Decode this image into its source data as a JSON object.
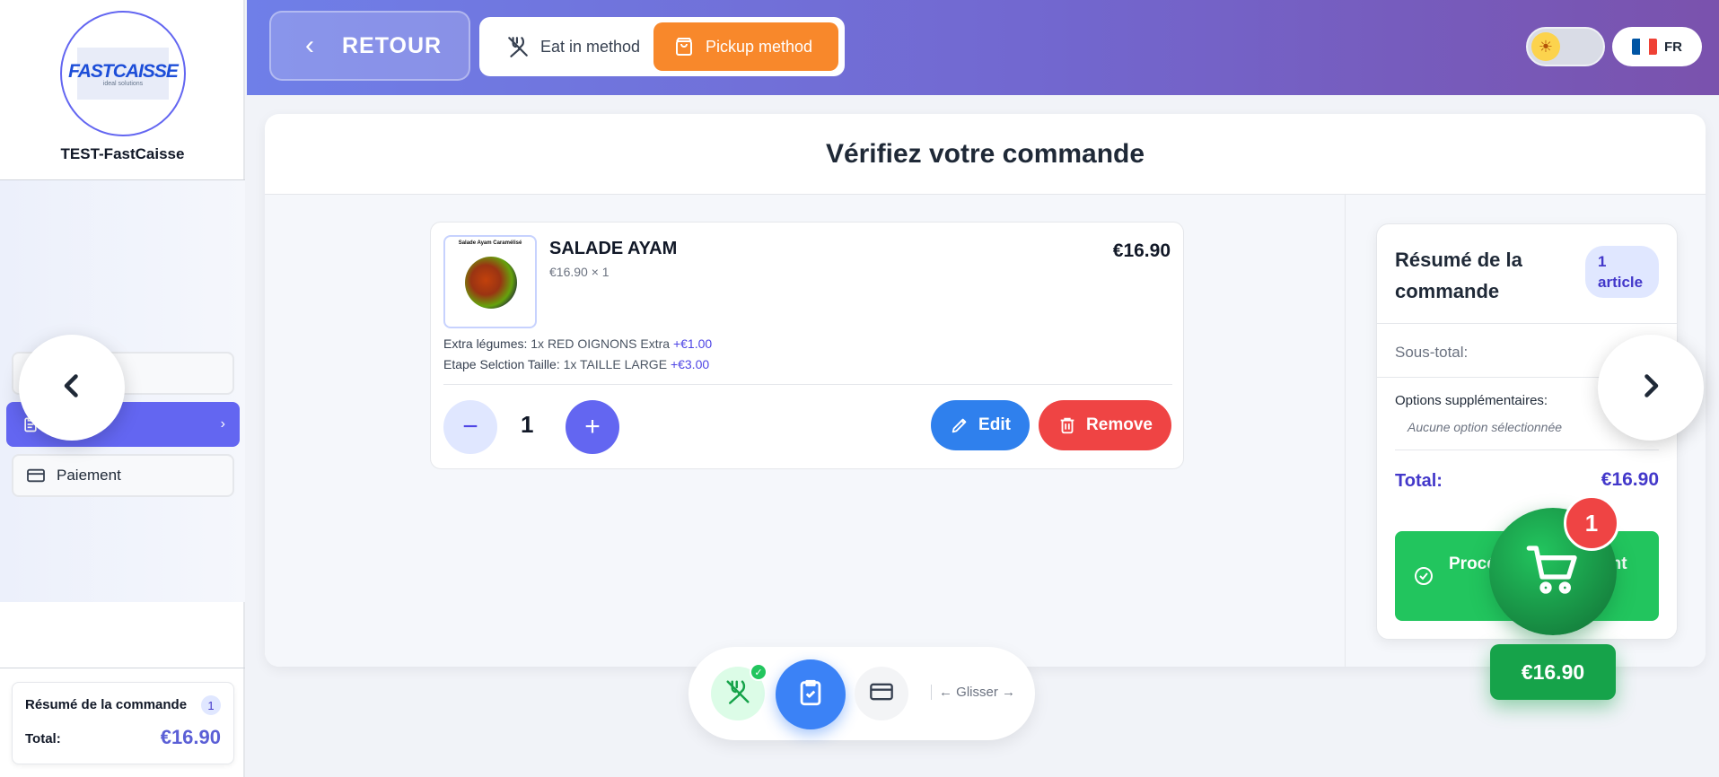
{
  "sidebar": {
    "logo_text": "FASTCAISSE",
    "logo_sub": "ideal solutions",
    "store_name": "TEST-FastCaisse",
    "items": [
      {
        "label": ""
      },
      {
        "label": "on"
      },
      {
        "label": "Paiement"
      }
    ],
    "summary": {
      "title": "Résumé de la commande",
      "count": "1",
      "total_label": "Total:",
      "total_value": "€16.90"
    }
  },
  "header": {
    "back_label": "RETOUR",
    "methods": [
      {
        "label": "Eat in method",
        "selected": false
      },
      {
        "label": "Pickup method",
        "selected": true
      }
    ],
    "theme_icon": "sun-icon",
    "language": "FR",
    "flag_colors": [
      "#0055a4",
      "#ffffff",
      "#ef4135"
    ]
  },
  "main": {
    "title": "Vérifiez votre commande",
    "item": {
      "image_caption": "Salade Ayam Caramélisé",
      "name": "SALADE AYAM",
      "unit_line": "€16.90 × 1",
      "price": "€16.90",
      "options": [
        {
          "label": "Extra légumes:",
          "value": "1x RED OIGNONS Extra",
          "extra": "+€1.00"
        },
        {
          "label": "Etape Selction Taille:",
          "value": "1x TAILLE LARGE",
          "extra": "+€3.00"
        }
      ],
      "quantity": "1",
      "edit_label": "Edit",
      "remove_label": "Remove"
    }
  },
  "summary": {
    "title": "Résumé de la commande",
    "badge": "1 article",
    "subtotal_label": "Sous-total:",
    "options_label": "Options supplémentaires:",
    "options_value": "Aucune option sélectionnée",
    "total_label": "Total:",
    "total_value": "€16.90",
    "proceed_label": "Procéder au paiement"
  },
  "cart": {
    "count": "1",
    "price": "€16.90"
  },
  "stepper": {
    "hint": "← Glisser →"
  },
  "colors": {
    "accent": "#6366f1",
    "pickup": "#f8882b",
    "success": "#22c55e",
    "danger": "#ef4444",
    "edit": "#2f80ed"
  }
}
